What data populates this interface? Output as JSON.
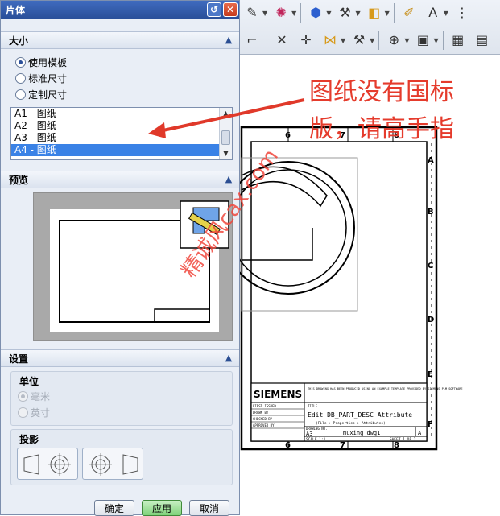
{
  "dialog": {
    "title": "片体",
    "size_section": {
      "title": "大小",
      "options": [
        {
          "label": "使用模板",
          "checked": true
        },
        {
          "label": "标准尺寸",
          "checked": false
        },
        {
          "label": "定制尺寸",
          "checked": false
        }
      ],
      "template_list": [
        "A1 - 图纸",
        "A2 - 图纸",
        "A3 - 图纸",
        "A4 - 图纸"
      ],
      "selected_index": 3
    },
    "preview_section": {
      "title": "预览"
    },
    "settings_section": {
      "title": "设置",
      "units": {
        "title": "单位",
        "options": [
          {
            "label": "毫米",
            "checked": true
          },
          {
            "label": "英寸",
            "checked": false
          }
        ]
      },
      "projection": {
        "title": "投影"
      }
    },
    "buttons": {
      "ok": "确定",
      "apply": "应用",
      "cancel": "取消"
    }
  },
  "drawing": {
    "zone_numbers_top": [
      "6",
      "7",
      "8"
    ],
    "zone_numbers_bottom": [
      "6",
      "7",
      "8"
    ],
    "zone_letters_right": [
      "A",
      "B",
      "C",
      "D",
      "E",
      "F"
    ],
    "title_block": {
      "company": "SIEMENS",
      "notice": "THIS DRAWING HAS BEEN PRODUCED USING AN EXAMPLE TEMPLATE PROVIDED BY SIEMENS PLM SOFTWARE",
      "title_label": "TITLE",
      "attribute_text": "Edit DB_PART_DESC Attribute",
      "attribute_sub": "(File > Properties > Attributes)",
      "first_issued": "FIRST ISSUED",
      "drawn_by": "DRAWN BY",
      "checked_by": "CHECKED BY",
      "approved_by": "APPROVED BY",
      "drawing_no_label": "DRAWING NO.",
      "size": "A3",
      "drawing_no": "muxing_dwg1",
      "rev": "A",
      "scale": "SCALE 1:1",
      "sheet": "SHEET 1 OF 2"
    }
  },
  "annotation": {
    "line1": "图纸没有国标",
    "line2": "版，请高手指"
  },
  "watermark": "精诚风cax.com",
  "colors": {
    "accent": "#2a4f99",
    "annotation": "#e53b2c",
    "selected": "#3a82e6"
  }
}
